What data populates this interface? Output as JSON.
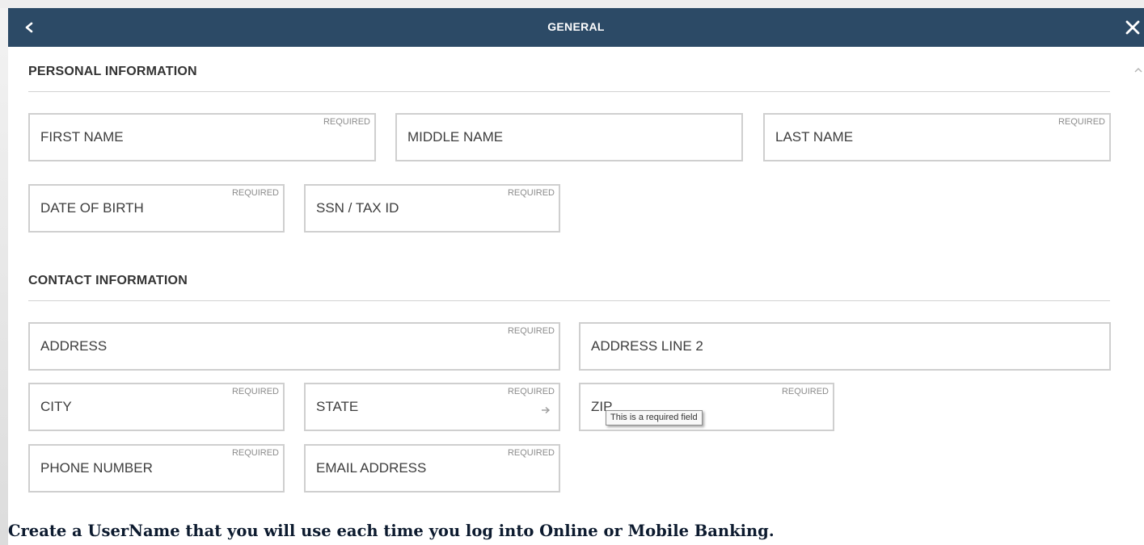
{
  "header": {
    "title": "GENERAL",
    "back_icon": "chevron-left-icon",
    "close_icon": "close-icon",
    "background": "#2c4a66"
  },
  "sections": {
    "personal": {
      "title": "PERSONAL INFORMATION"
    },
    "contact": {
      "title": "CONTACT INFORMATION"
    }
  },
  "required_label": "REQUIRED",
  "fields": {
    "first_name": {
      "label": "FIRST NAME",
      "required": true
    },
    "middle_name": {
      "label": "MIDDLE NAME",
      "required": false
    },
    "last_name": {
      "label": "LAST NAME",
      "required": true
    },
    "date_of_birth": {
      "label": "DATE OF BIRTH",
      "required": true
    },
    "ssn_tax_id": {
      "label": "SSN / TAX ID",
      "required": true
    },
    "address": {
      "label": "ADDRESS",
      "required": true
    },
    "address_line_2": {
      "label": "ADDRESS LINE 2",
      "required": false
    },
    "city": {
      "label": "CITY",
      "required": true
    },
    "state": {
      "label": "STATE",
      "required": true,
      "icon": "arrow-right-icon"
    },
    "zip": {
      "label": "ZIP",
      "required": true
    },
    "phone_number": {
      "label": "PHONE NUMBER",
      "required": true
    },
    "email_address": {
      "label": "EMAIL ADDRESS",
      "required": true
    }
  },
  "tooltip": {
    "text": "This is a required field"
  },
  "footer": {
    "text": "Create a UserName that you will use each time you log into Online or Mobile Banking."
  }
}
